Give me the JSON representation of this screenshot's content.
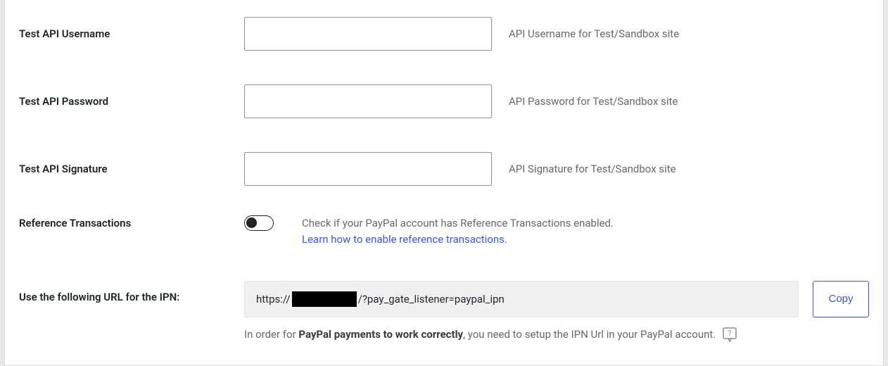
{
  "fields": {
    "test_api_username": {
      "label": "Test API Username",
      "value": "",
      "help": "API Username for Test/Sandbox site"
    },
    "test_api_password": {
      "label": "Test API Password",
      "value": "",
      "help": "API Password for Test/Sandbox site"
    },
    "test_api_signature": {
      "label": "Test API Signature",
      "value": "",
      "help": "API Signature for Test/Sandbox site"
    }
  },
  "reference_transactions": {
    "label": "Reference Transactions",
    "enabled": false,
    "help": "Check if your PayPal account has Reference Transactions enabled.",
    "link_text": "Learn how to enable reference transactions."
  },
  "ipn": {
    "label": "Use the following URL for the IPN:",
    "url_prefix": "https://",
    "url_suffix": "/?pay_gate_listener=paypal_ipn",
    "copy_label": "Copy",
    "note_prefix": "In order for ",
    "note_bold": "PayPal payments to work correctly",
    "note_suffix": ", you need to setup the IPN Url in your PayPal account."
  }
}
